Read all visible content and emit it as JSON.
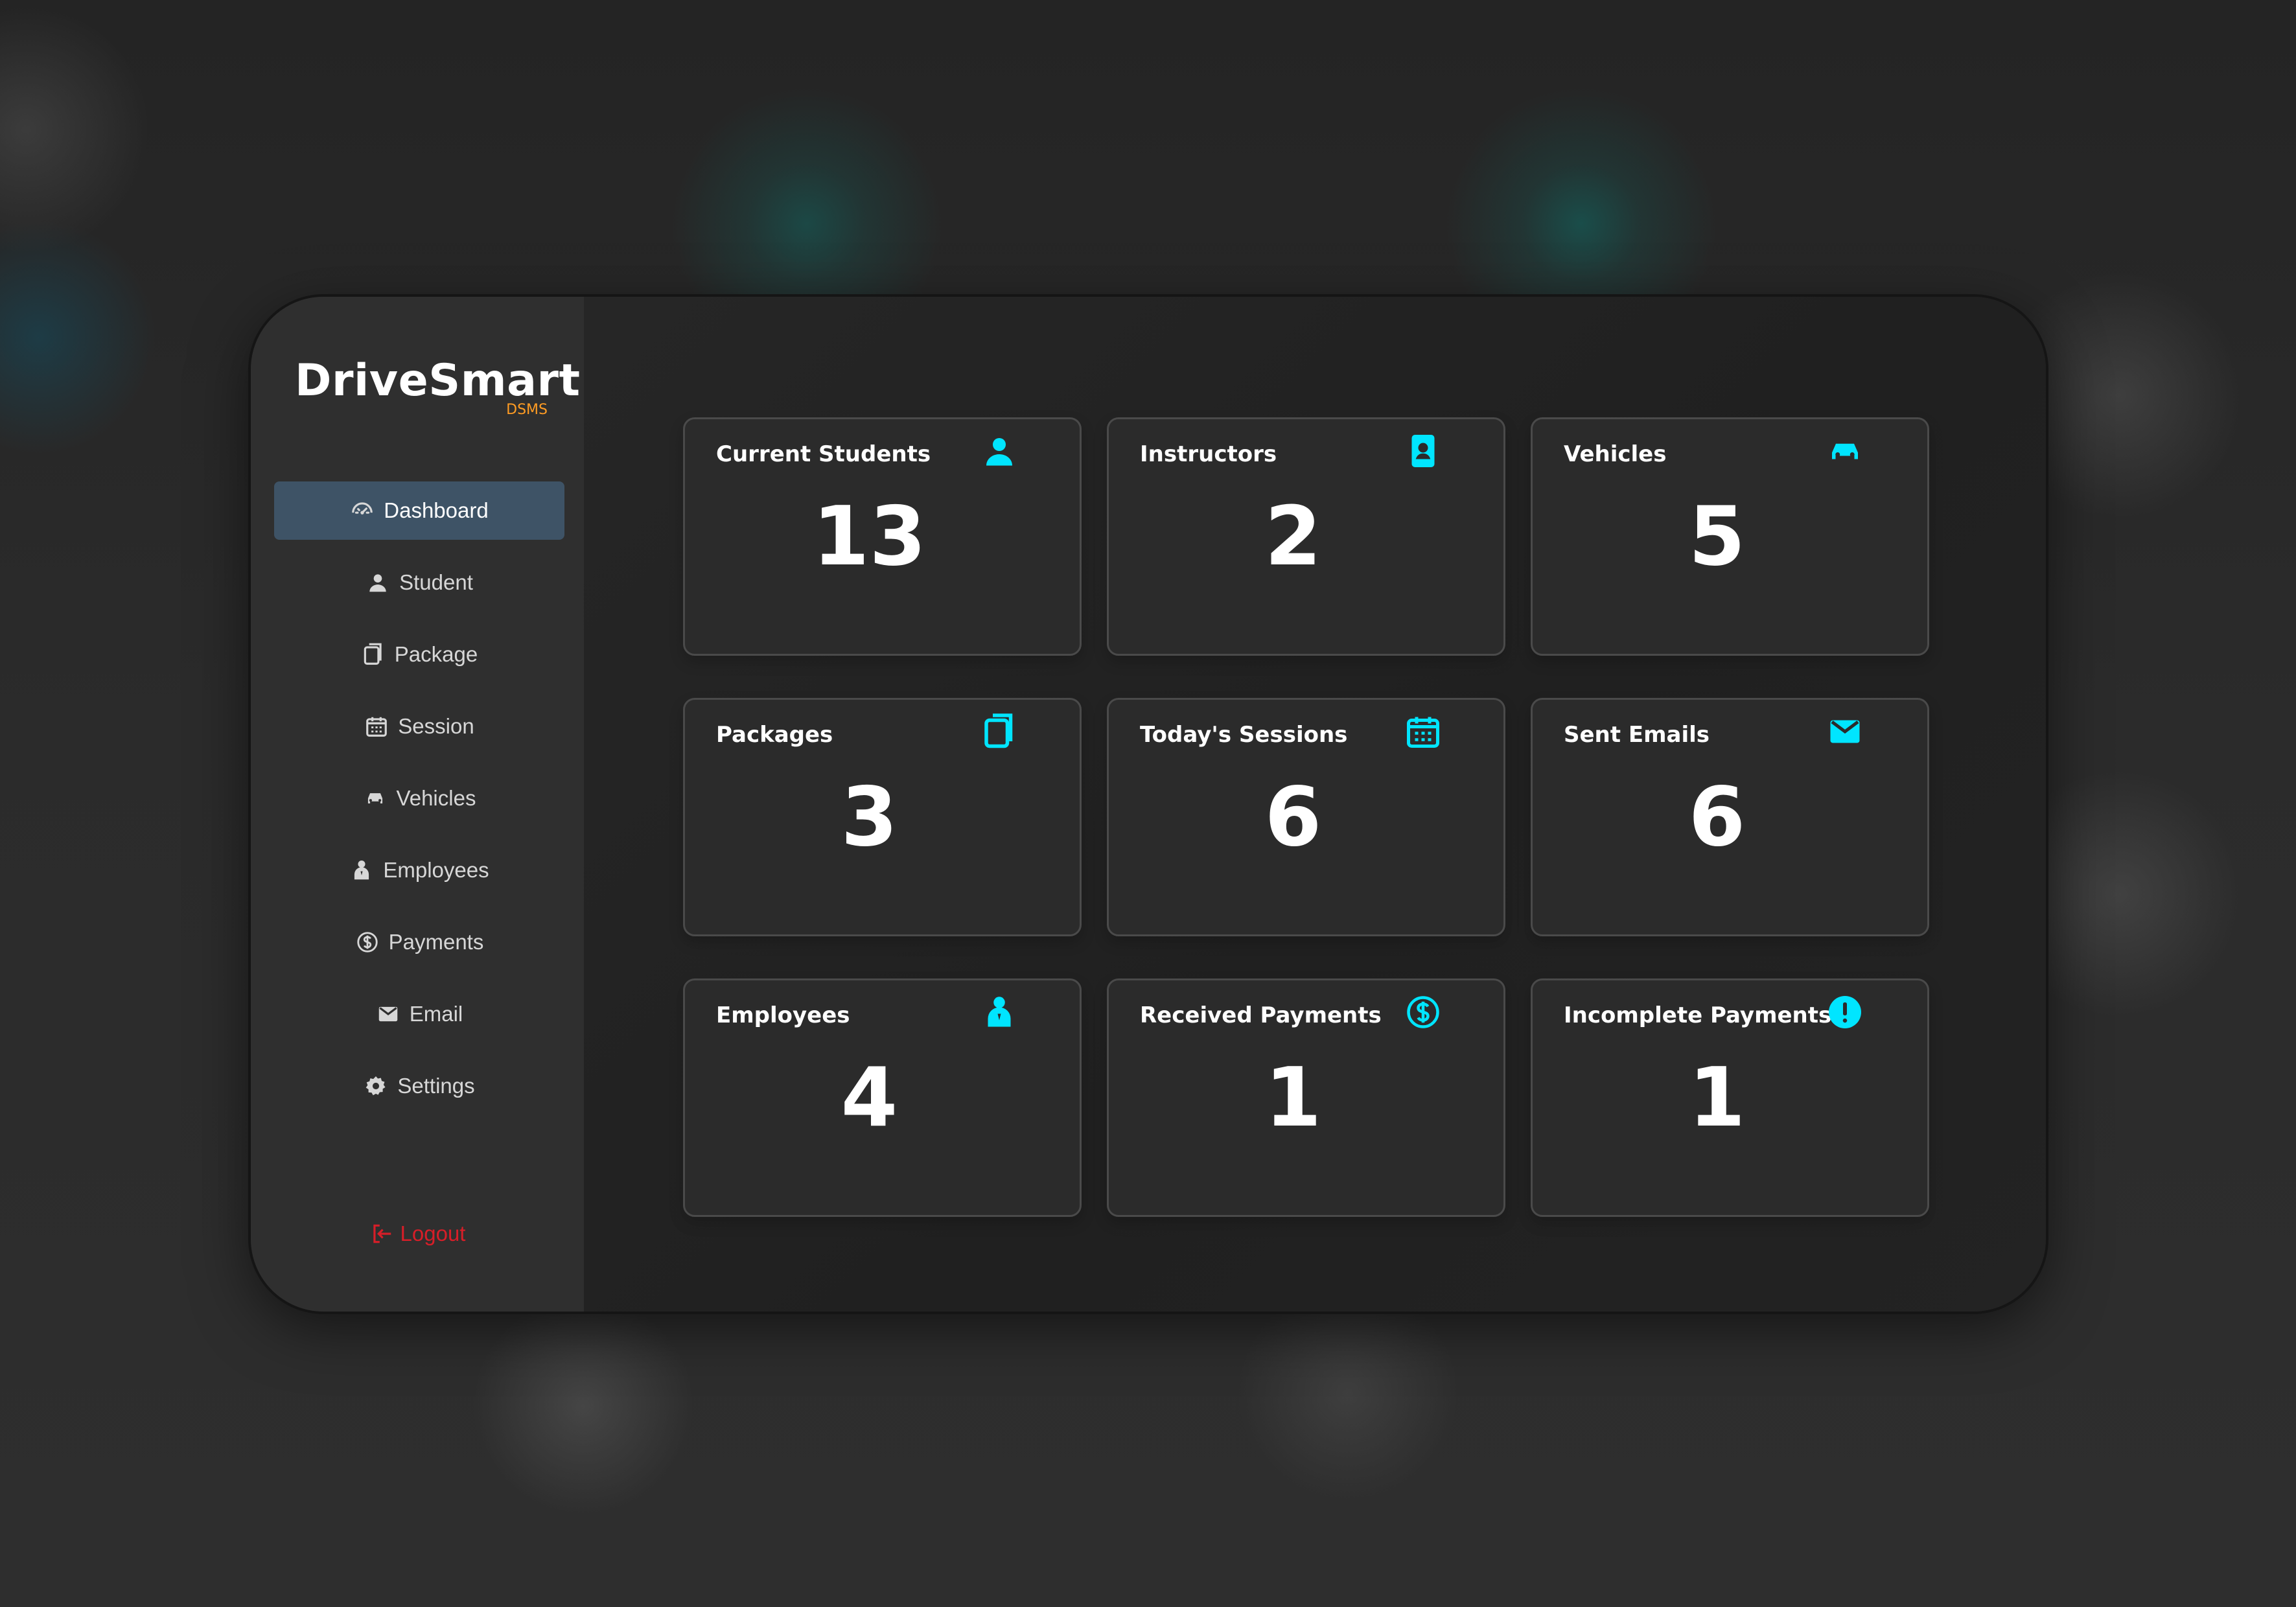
{
  "app": {
    "name": "DriveSmart",
    "subtitle": "DSMS"
  },
  "sidebar": {
    "items": [
      {
        "label": "Dashboard",
        "icon": "dashboard-icon",
        "active": true
      },
      {
        "label": "Student",
        "icon": "user-icon",
        "active": false
      },
      {
        "label": "Package",
        "icon": "package-icon",
        "active": false
      },
      {
        "label": "Session",
        "icon": "calendar-icon",
        "active": false
      },
      {
        "label": "Vehicles",
        "icon": "car-icon",
        "active": false
      },
      {
        "label": "Employees",
        "icon": "employees-icon",
        "active": false
      },
      {
        "label": "Payments",
        "icon": "dollar-icon",
        "active": false
      },
      {
        "label": "Email",
        "icon": "envelope-icon",
        "active": false
      },
      {
        "label": "Settings",
        "icon": "gear-icon",
        "active": false
      }
    ],
    "logout_label": "Logout"
  },
  "dashboard": {
    "cards": [
      {
        "title": "Current Students",
        "value": "13",
        "icon": "user-icon"
      },
      {
        "title": "Instructors",
        "value": "2",
        "icon": "instructor-id-icon"
      },
      {
        "title": "Vehicles",
        "value": "5",
        "icon": "car-icon"
      },
      {
        "title": "Packages",
        "value": "3",
        "icon": "package-icon"
      },
      {
        "title": "Today's Sessions",
        "value": "6",
        "icon": "calendar-icon"
      },
      {
        "title": "Sent Emails",
        "value": "6",
        "icon": "envelope-icon"
      },
      {
        "title": "Employees",
        "value": "4",
        "icon": "employees-icon"
      },
      {
        "title": "Received Payments",
        "value": "1",
        "icon": "dollar-icon"
      },
      {
        "title": "Incomplete Payments",
        "value": "1",
        "icon": "warning-icon"
      }
    ]
  },
  "colors": {
    "accent": "#00e5ff",
    "logout": "#d71e28",
    "brand_sub": "#ff9c23",
    "sidebar_bg": "#2f2f2f",
    "content_bg": "#222222",
    "card_bg": "#2b2b2b",
    "card_border": "#4a4a4a",
    "active_bg": "#3e5366"
  }
}
